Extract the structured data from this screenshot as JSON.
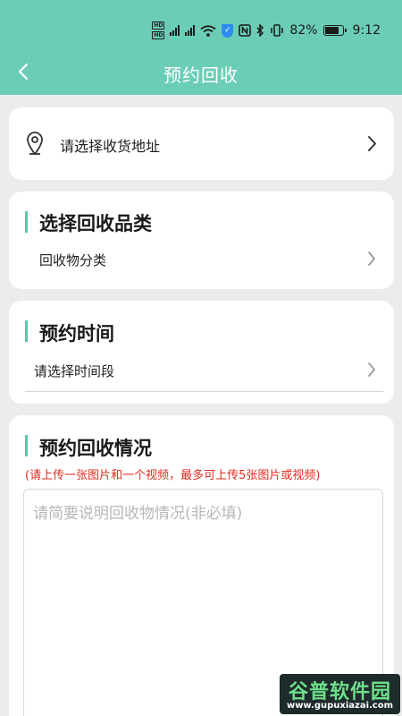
{
  "status_bar": {
    "hd_badge": "HD",
    "battery_percent": "82%",
    "time": "9:12",
    "battery_level": 0.82
  },
  "header": {
    "title": "预约回收",
    "back_icon": "back-arrow-icon",
    "background_color": "#6ccdb6"
  },
  "address": {
    "label": "请选择收货地址",
    "icon": "location-pin-icon"
  },
  "category_section": {
    "title": "选择回收品类",
    "row_label": "回收物分类"
  },
  "time_section": {
    "title": "预约时间",
    "row_label": "请选择时间段"
  },
  "situation_section": {
    "title": "预约回收情况",
    "notice": "(请上传一张图片和一个视频，最多可上传5张图片或视频)",
    "notice_color": "#e12c1f",
    "placeholder": "请简要说明回收物情况(非必填)",
    "value": ""
  },
  "accent_color": "#5fc4ad",
  "watermark": {
    "title": "谷普软件园",
    "url": "www.gupuxiazai.com"
  }
}
